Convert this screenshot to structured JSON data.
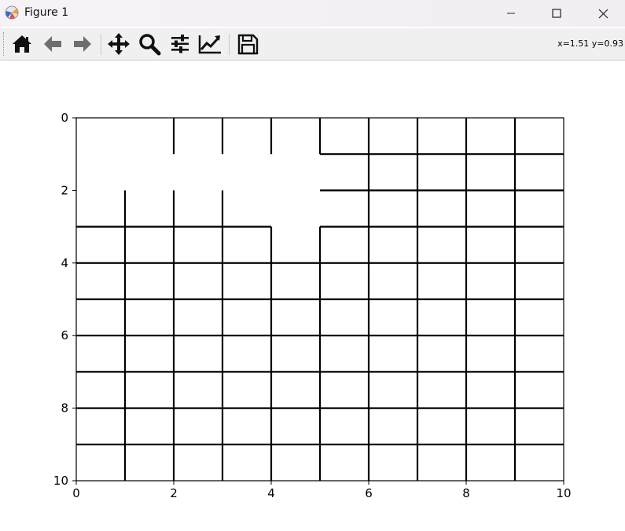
{
  "window": {
    "title": "Figure 1"
  },
  "icons": {
    "app": "matplotlib-icon",
    "minimize": "minimize-icon",
    "maximize": "maximize-icon",
    "close": "close-icon"
  },
  "toolbar": {
    "buttons": [
      {
        "name": "home",
        "icon": "home-icon"
      },
      {
        "name": "back",
        "icon": "back-arrow-icon"
      },
      {
        "name": "forward",
        "icon": "forward-arrow-icon"
      },
      {
        "name": "pan",
        "icon": "move-icon"
      },
      {
        "name": "zoom",
        "icon": "zoom-icon"
      },
      {
        "name": "configure-subplots",
        "icon": "sliders-icon"
      },
      {
        "name": "edit-axes",
        "icon": "line-chart-icon"
      },
      {
        "name": "save",
        "icon": "save-icon"
      }
    ],
    "coords": "x=1.51 y=0.93"
  },
  "chart_data": {
    "type": "grid",
    "xlim": [
      0,
      10
    ],
    "ylim": [
      10,
      0
    ],
    "y_inverted": true,
    "xticks": [
      "0",
      "2",
      "4",
      "6",
      "8",
      "10"
    ],
    "yticks": [
      "0",
      "2",
      "4",
      "6",
      "8",
      "10"
    ],
    "grid": false,
    "line_color": "#000000",
    "horizontal_segments": [
      {
        "y": 1,
        "x": [
          [
            5,
            10
          ]
        ]
      },
      {
        "y": 2,
        "x": [
          [
            5,
            10
          ]
        ]
      },
      {
        "y": 3,
        "x": [
          [
            0,
            4
          ],
          [
            5,
            10
          ]
        ]
      },
      {
        "y": 4,
        "x": [
          [
            0,
            10
          ]
        ]
      },
      {
        "y": 5,
        "x": [
          [
            0,
            10
          ]
        ]
      },
      {
        "y": 6,
        "x": [
          [
            0,
            10
          ]
        ]
      },
      {
        "y": 7,
        "x": [
          [
            0,
            10
          ]
        ]
      },
      {
        "y": 8,
        "x": [
          [
            0,
            10
          ]
        ]
      },
      {
        "y": 9,
        "x": [
          [
            0,
            10
          ]
        ]
      }
    ],
    "vertical_segments": [
      {
        "x": 1,
        "y": [
          [
            2,
            10
          ]
        ]
      },
      {
        "x": 2,
        "y": [
          [
            0,
            1
          ],
          [
            2,
            10
          ]
        ]
      },
      {
        "x": 3,
        "y": [
          [
            0,
            1
          ],
          [
            2,
            10
          ]
        ]
      },
      {
        "x": 4,
        "y": [
          [
            0,
            1
          ],
          [
            3,
            10
          ]
        ]
      },
      {
        "x": 5,
        "y": [
          [
            0,
            1
          ],
          [
            3,
            10
          ]
        ]
      },
      {
        "x": 6,
        "y": [
          [
            0,
            10
          ]
        ]
      },
      {
        "x": 7,
        "y": [
          [
            0,
            10
          ]
        ]
      },
      {
        "x": 8,
        "y": [
          [
            0,
            10
          ]
        ]
      },
      {
        "x": 9,
        "y": [
          [
            0,
            10
          ]
        ]
      }
    ]
  }
}
